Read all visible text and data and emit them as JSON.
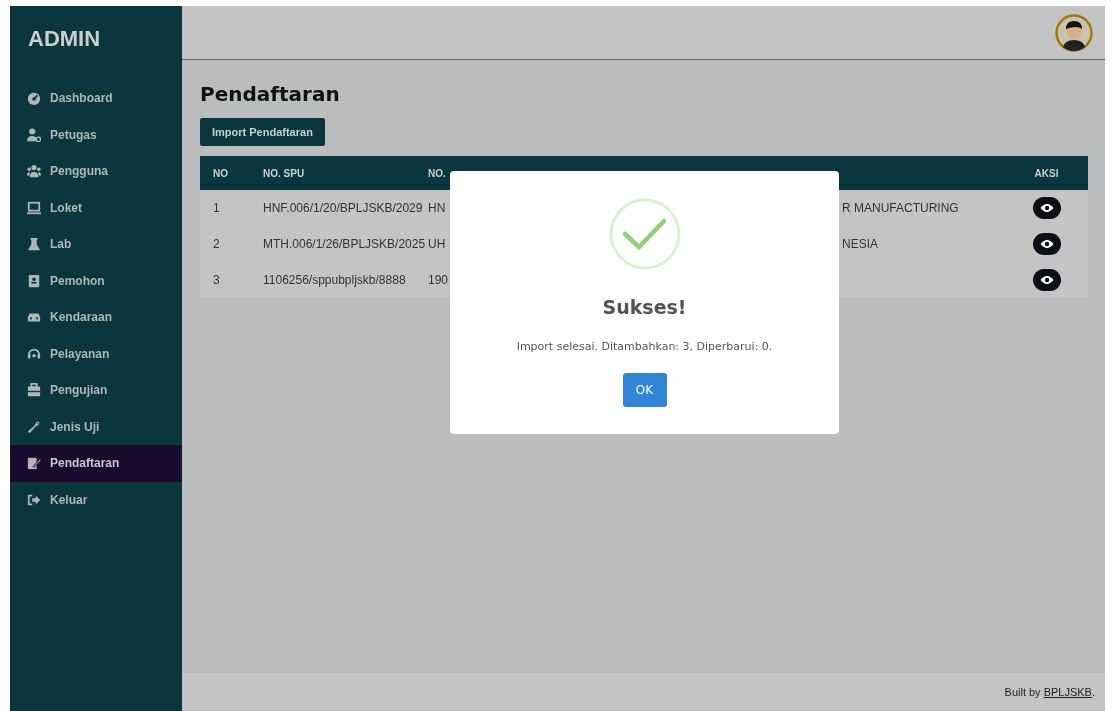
{
  "sidebar": {
    "brand": "ADMIN",
    "items": [
      {
        "label": "Dashboard",
        "selected": false
      },
      {
        "label": "Petugas",
        "selected": false
      },
      {
        "label": "Pengguna",
        "selected": false
      },
      {
        "label": "Loket",
        "selected": false
      },
      {
        "label": "Lab",
        "selected": false
      },
      {
        "label": "Pemohon",
        "selected": false
      },
      {
        "label": "Kendaraan",
        "selected": false
      },
      {
        "label": "Pelayanan",
        "selected": false
      },
      {
        "label": "Pengujian",
        "selected": false
      },
      {
        "label": "Jenis Uji",
        "selected": false
      },
      {
        "label": "Pendaftaran",
        "selected": true
      },
      {
        "label": "Keluar",
        "selected": false
      }
    ]
  },
  "page": {
    "title": "Pendaftaran",
    "import_button": "Import Pendaftaran"
  },
  "table": {
    "columns": [
      "NO",
      "NO. SPU",
      "NO.",
      "",
      "AKSI"
    ],
    "rows": [
      {
        "no": "1",
        "no_spu": "HNF.006/1/20/BPLJSKB/2029",
        "column_3": "HN",
        "column_4": "R MANUFACTURING"
      },
      {
        "no": "2",
        "no_spu": "MTH.006/1/26/BPLJSKB/2025",
        "column_3": "UH",
        "column_4": "NESIA"
      },
      {
        "no": "3",
        "no_spu": "1106256/sppubpljskb/8888",
        "column_3": "190",
        "column_4": ""
      }
    ]
  },
  "dialog": {
    "title": "Sukses!",
    "message": "Import selesai. Ditambahkan: 3, Diperbarui: 0.",
    "button": "OK"
  },
  "footer": {
    "text": "Built by",
    "link": "BPLJSKB",
    "suffix": "."
  }
}
